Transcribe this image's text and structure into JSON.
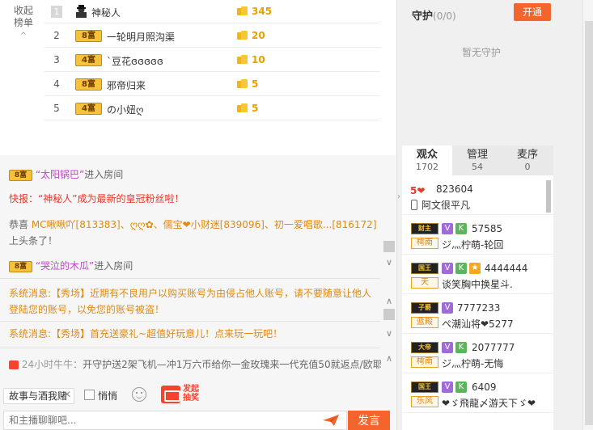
{
  "rank": {
    "collapse_label": "收起榜单",
    "rows": [
      {
        "rank": "1",
        "level": "",
        "name": "神秘人",
        "amount": "345"
      },
      {
        "rank": "2",
        "level": "8富",
        "name": "一轮明月照沟渠",
        "amount": "20"
      },
      {
        "rank": "3",
        "level": "4富",
        "name": "`豆花ɞɞɞɞɞ",
        "amount": "10"
      },
      {
        "rank": "4",
        "level": "8富",
        "name": "邪帝归来",
        "amount": "5"
      },
      {
        "rank": "5",
        "level": "4富",
        "name": "の小妞ღ",
        "amount": "5"
      }
    ]
  },
  "chat": {
    "msg1": {
      "badge": "8富",
      "user": "“太阳锅巴”",
      "text": "进入房间"
    },
    "msg2": {
      "prefix": "快报：",
      "text": "“神秘人”成为最新的皇冠粉丝啦！"
    },
    "msg3": {
      "prefix": "恭喜 ",
      "text": "MC啾啾吖[813383]、ღღ✿、儒宝❤小财迷[839096]、初一爱唱歌...[816172]",
      "suffix": " 上头条了！"
    },
    "msg4": {
      "badge": "8富",
      "user": "“哭泣的木瓜”",
      "text": "进入房间"
    },
    "msg5": {
      "label": "系统消息:",
      "text": "【秀场】近期有不良用户以购买账号为由侵占他人账号，请不要随意让他人登陆您的账号，以免您的账号被盗！"
    },
    "msg6": {
      "label": "系统消息:",
      "text": "【秀场】首充送豪礼~超值好玩意儿！点来玩一玩吧！"
    },
    "ticker": {
      "time": "24小时牛牛：",
      "text": "开守护送2架飞机—冲1万六币给你一金玫瑰来一代充值50就返点/欧耶"
    }
  },
  "input": {
    "story_tab": "故事与酒我赌",
    "quiet_label": "悄悄",
    "lottery_label": "发起抽奖",
    "placeholder": "和主播聊聊吧...",
    "send_label": "发言"
  },
  "guard": {
    "title": "守护",
    "count": "(0/0)",
    "open_button": "开通",
    "empty_text": "暂无守护"
  },
  "tabs": [
    {
      "label": "观众",
      "count": "1702"
    },
    {
      "label": "管理",
      "count": "54"
    },
    {
      "label": "麦序",
      "count": "0"
    }
  ],
  "audience": [
    {
      "num": "823604",
      "nick": "阿文很平凡",
      "tag": "",
      "badge": "5❤"
    },
    {
      "num": "57585",
      "nick": "ジ灬柠萌-轮回",
      "tag": "樗南",
      "badge": "财主"
    },
    {
      "num": "4444444",
      "nick": "谈笑胸中换星斗.",
      "tag": "天",
      "badge": "国王"
    },
    {
      "num": "7777233",
      "nick": "ペ潮汕将❤5277",
      "tag": "蓝殿",
      "badge": "子爵"
    },
    {
      "num": "2077777",
      "nick": "ジ灬柠萌-无悔",
      "tag": "樗南",
      "badge": "大帝"
    },
    {
      "num": "6409",
      "nick": "❤ゞ飛龍〆游天下ゞ❤",
      "tag": "乐风",
      "badge": "国王"
    }
  ],
  "colors": {
    "accent": "#f4652e",
    "gold": "#e6a000",
    "system": "#e08a0f",
    "alert": "#e23a2b",
    "username": "#c044c8"
  }
}
